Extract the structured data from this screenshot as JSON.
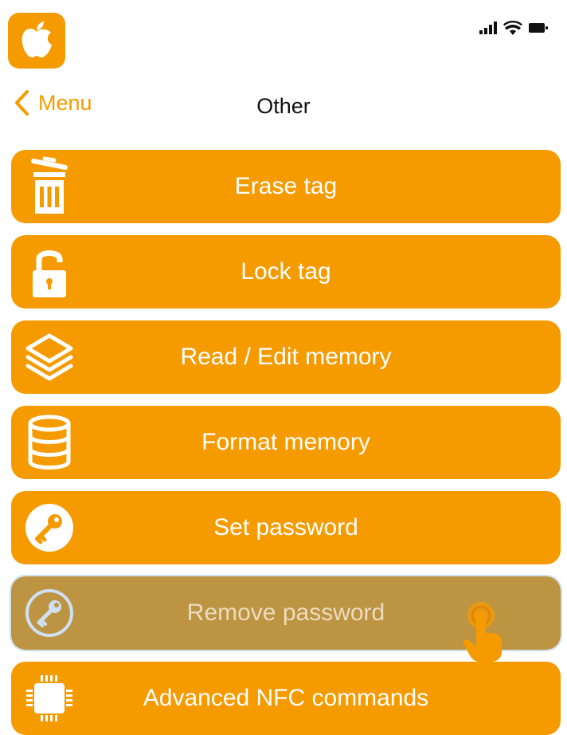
{
  "status_bar": {
    "app_icon": "apple-logo-icon",
    "icons": [
      "signal-bars-icon",
      "wifi-icon",
      "battery-icon"
    ]
  },
  "nav": {
    "back_label": "Menu",
    "title": "Other"
  },
  "menu": {
    "items": [
      {
        "label": "Erase tag",
        "icon": "trash-icon"
      },
      {
        "label": "Lock tag",
        "icon": "padlock-icon"
      },
      {
        "label": "Read / Edit memory",
        "icon": "layers-icon"
      },
      {
        "label": "Format memory",
        "icon": "database-icon"
      },
      {
        "label": "Set password",
        "icon": "key-icon"
      },
      {
        "label": "Remove password",
        "icon": "key-outline-icon",
        "state": "pressed"
      },
      {
        "label": "Advanced NFC commands",
        "icon": "chip-icon"
      }
    ]
  },
  "colors": {
    "accent": "#f59b00",
    "pressed": "#bd9442",
    "text_on_accent": "#ffffff"
  }
}
